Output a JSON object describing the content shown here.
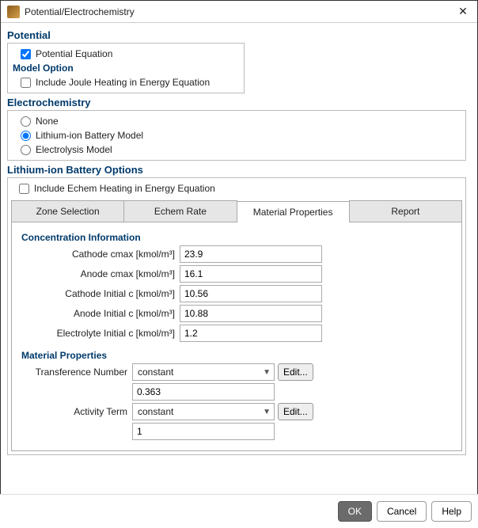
{
  "window": {
    "title": "Potential/Electrochemistry",
    "close": "✕"
  },
  "potential": {
    "heading": "Potential",
    "equation_label": "Potential Equation",
    "equation_checked": true,
    "model_option_heading": "Model Option",
    "joule_label": "Include Joule Heating in Energy Equation",
    "joule_checked": false
  },
  "electrochemistry": {
    "heading": "Electrochemistry",
    "options": {
      "none": "None",
      "lithium": "Lithium-ion Battery Model",
      "electrolysis": "Electrolysis Model"
    },
    "selected": "lithium"
  },
  "lithium_options": {
    "heading": "Lithium-ion Battery Options",
    "echem_heating_label": "Include Echem Heating in Energy Equation",
    "echem_heating_checked": false,
    "tabs": {
      "zone": "Zone Selection",
      "echem_rate": "Echem Rate",
      "material": "Material Properties",
      "report": "Report"
    },
    "active_tab": "material",
    "concentration": {
      "heading": "Concentration Information",
      "cathode_cmax_label": "Cathode cmax [kmol/m³]",
      "cathode_cmax_value": "23.9",
      "anode_cmax_label": "Anode cmax [kmol/m³]",
      "anode_cmax_value": "16.1",
      "cathode_initial_label": "Cathode Initial c [kmol/m³]",
      "cathode_initial_value": "10.56",
      "anode_initial_label": "Anode Initial c [kmol/m³]",
      "anode_initial_value": "10.88",
      "electrolyte_initial_label": "Electrolyte Initial c [kmol/m³]",
      "electrolyte_initial_value": "1.2"
    },
    "material_props": {
      "heading": "Material Properties",
      "transference_label": "Transference Number",
      "transference_type": "constant",
      "transference_value": "0.363",
      "activity_label": "Activity Term",
      "activity_type": "constant",
      "activity_value": "1",
      "edit_label": "Edit..."
    }
  },
  "footer": {
    "ok": "OK",
    "cancel": "Cancel",
    "help": "Help"
  }
}
